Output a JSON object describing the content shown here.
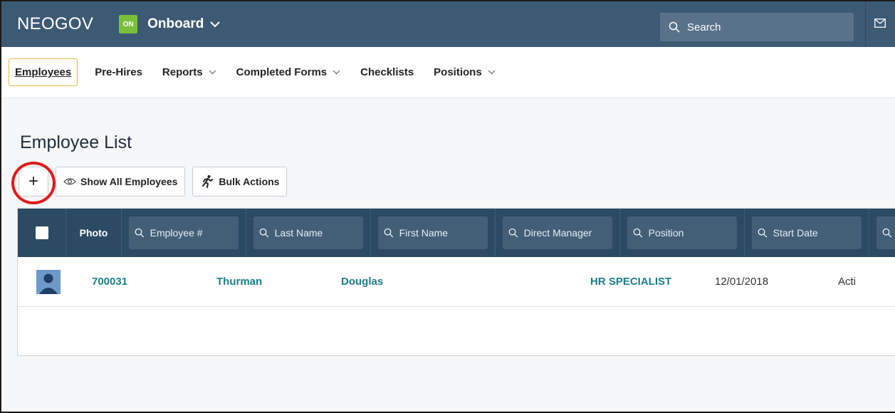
{
  "app": {
    "brand": "NEOGOV",
    "badge": "ON",
    "product": "Onboard",
    "search_placeholder": "Search"
  },
  "nav": {
    "items": [
      {
        "label": "Employees",
        "active": true,
        "dropdown": false
      },
      {
        "label": "Pre-Hires",
        "active": false,
        "dropdown": false
      },
      {
        "label": "Reports",
        "active": false,
        "dropdown": true
      },
      {
        "label": "Completed Forms",
        "active": false,
        "dropdown": true
      },
      {
        "label": "Checklists",
        "active": false,
        "dropdown": false
      },
      {
        "label": "Positions",
        "active": false,
        "dropdown": true
      }
    ]
  },
  "page": {
    "title": "Employee List",
    "add_label": "+",
    "show_all_label": "Show All Employees",
    "bulk_actions_label": "Bulk Actions"
  },
  "table": {
    "photo_header": "Photo",
    "filters": [
      "Employee #",
      "Last Name",
      "First Name",
      "Direct Manager",
      "Position",
      "Start Date",
      ""
    ],
    "rows": [
      {
        "employee_number": "700031",
        "last_name": "Thurman",
        "first_name": "Douglas",
        "direct_manager": "",
        "position": "HR SPECIALIST",
        "start_date": "12/01/2018",
        "status": "Acti"
      }
    ]
  },
  "colors": {
    "topbar": "#3d5a74",
    "table_header": "#2c4a64",
    "badge": "#7bbf3a",
    "link": "#1a7f8a",
    "highlight_circle": "#e01b1b"
  }
}
